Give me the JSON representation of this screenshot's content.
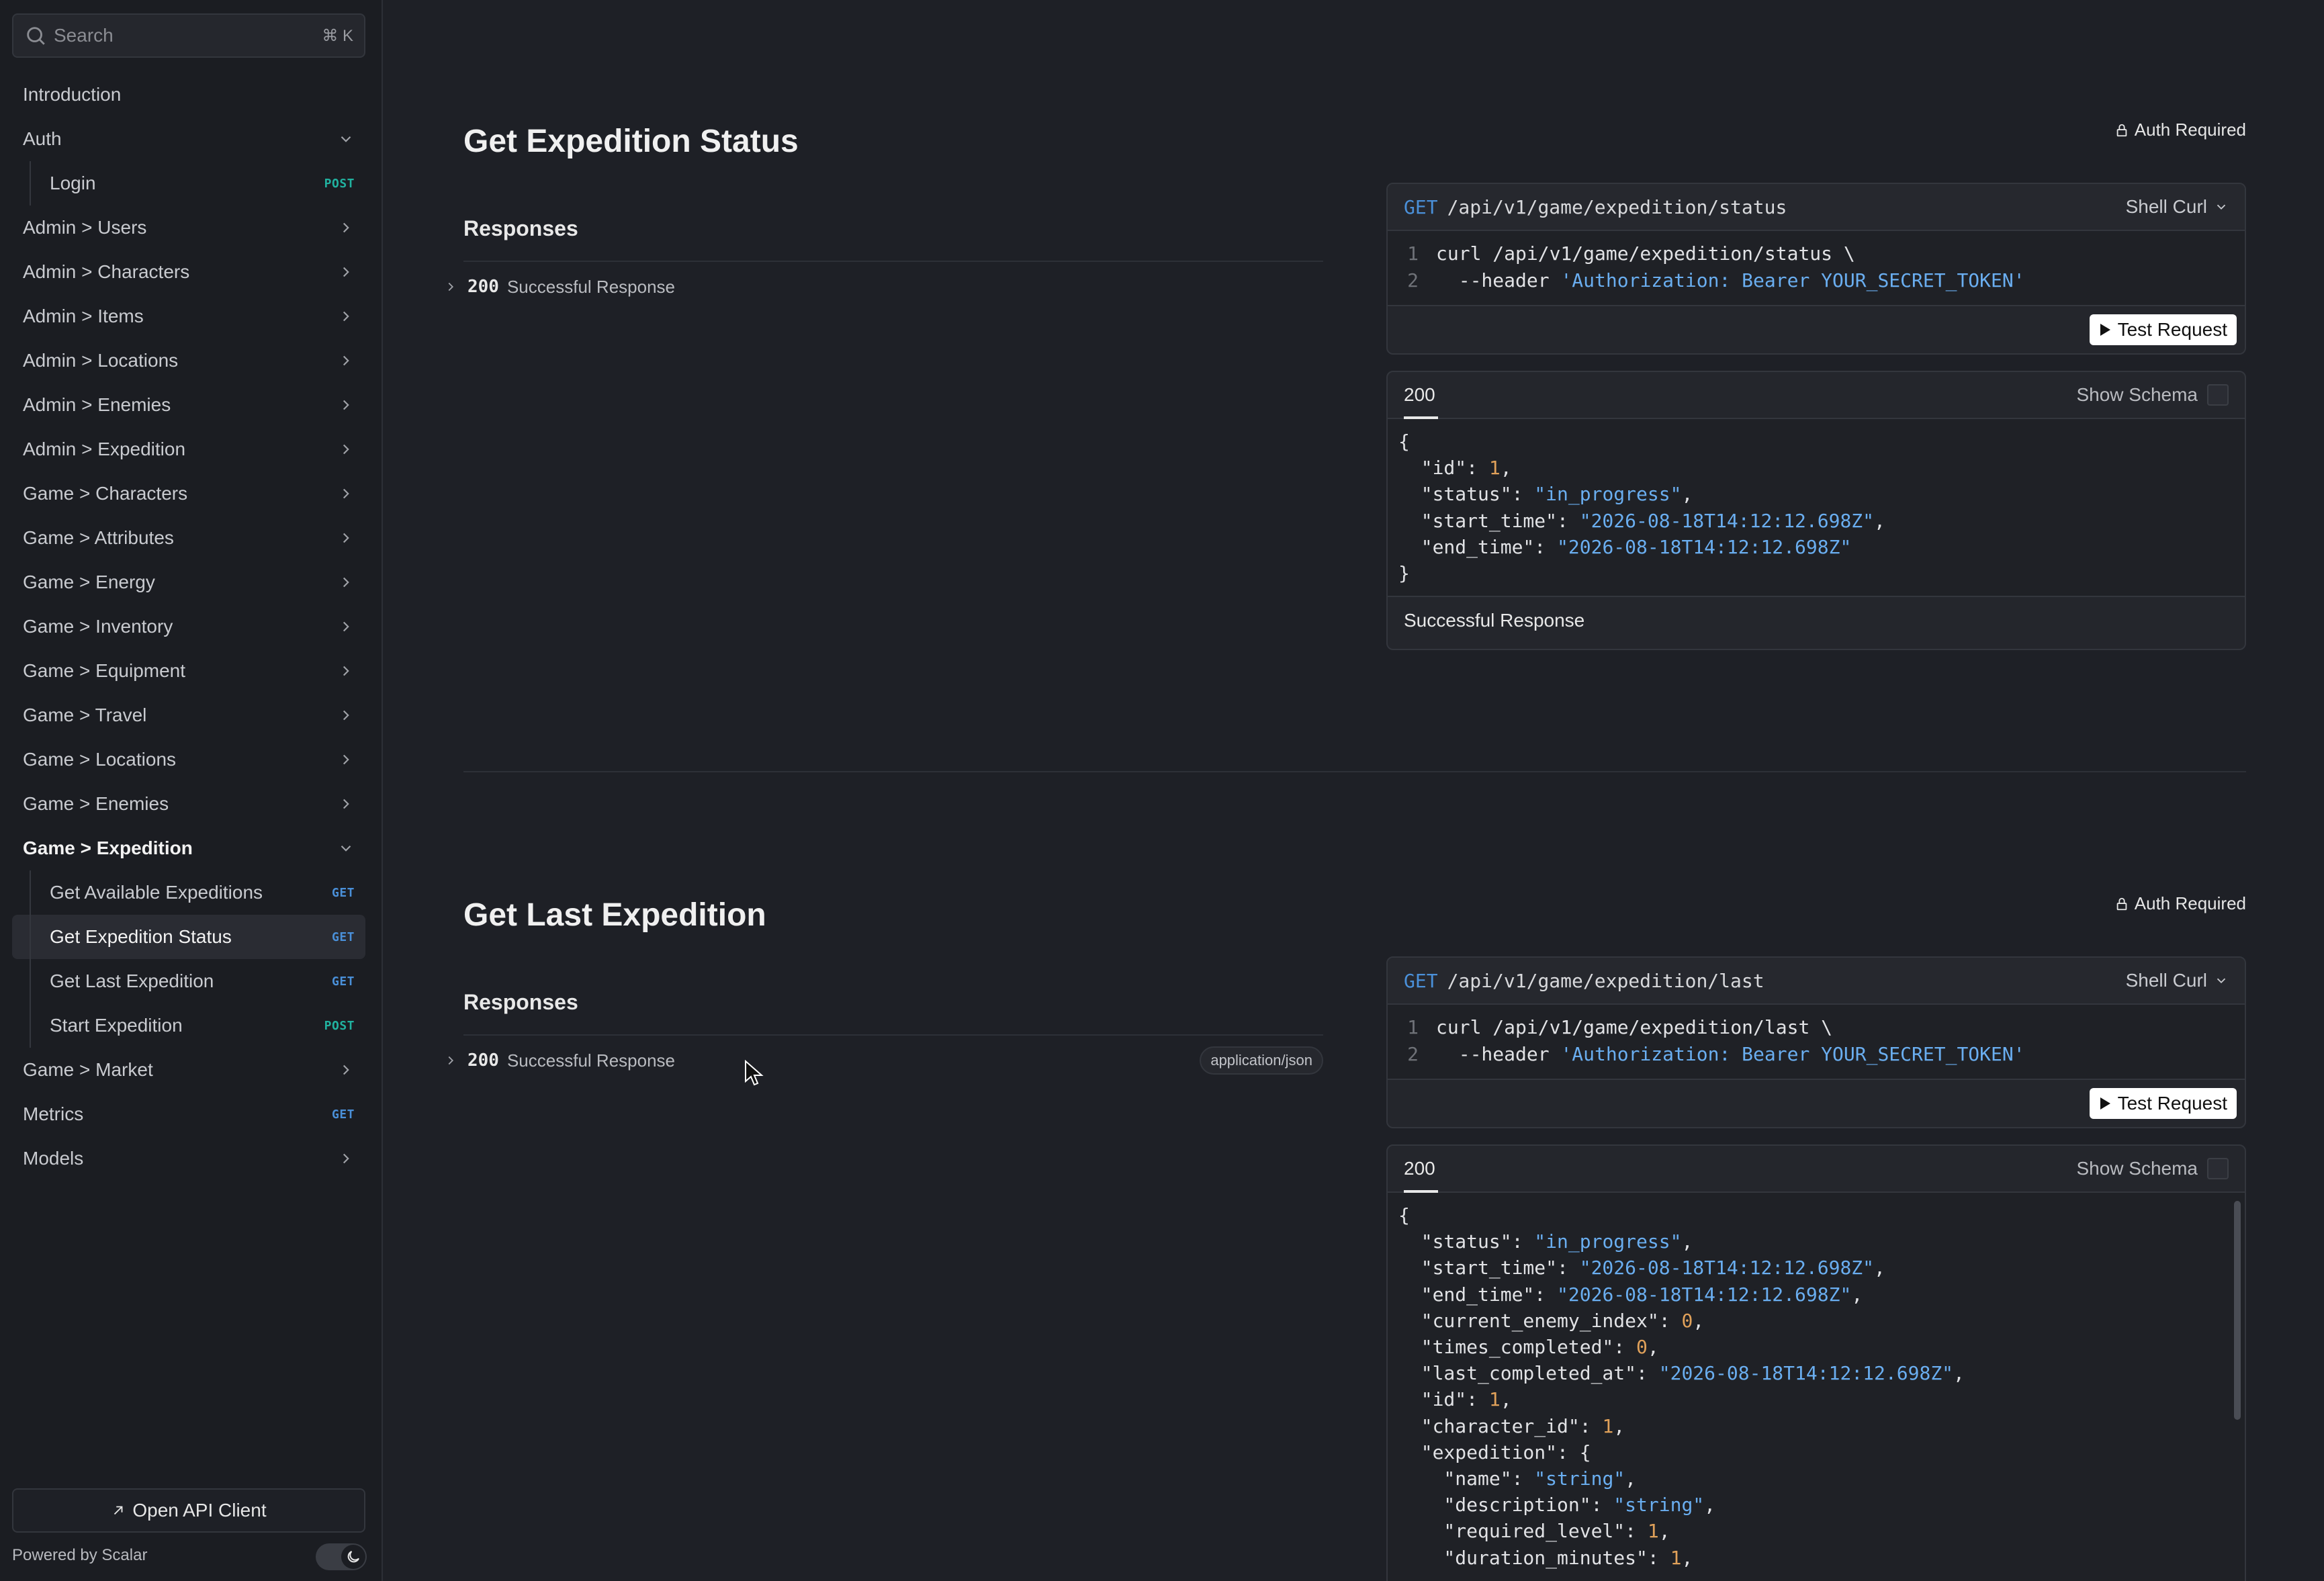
{
  "sidebar": {
    "search": {
      "placeholder": "Search",
      "shortcut": "⌘ K"
    },
    "items": [
      {
        "label": "Introduction"
      },
      {
        "label": "Auth"
      },
      {
        "label": "Login",
        "badge": "POST"
      },
      {
        "label": "Admin > Users"
      },
      {
        "label": "Admin > Characters"
      },
      {
        "label": "Admin > Items"
      },
      {
        "label": "Admin > Locations"
      },
      {
        "label": "Admin > Enemies"
      },
      {
        "label": "Admin > Expedition"
      },
      {
        "label": "Game > Characters"
      },
      {
        "label": "Game > Attributes"
      },
      {
        "label": "Game > Energy"
      },
      {
        "label": "Game > Inventory"
      },
      {
        "label": "Game > Equipment"
      },
      {
        "label": "Game > Travel"
      },
      {
        "label": "Game > Locations"
      },
      {
        "label": "Game > Enemies"
      },
      {
        "label": "Game > Expedition"
      },
      {
        "label": "Get Available Expeditions",
        "badge": "GET"
      },
      {
        "label": "Get Expedition Status",
        "badge": "GET"
      },
      {
        "label": "Get Last Expedition",
        "badge": "GET"
      },
      {
        "label": "Start Expedition",
        "badge": "POST"
      },
      {
        "label": "Game > Market"
      },
      {
        "label": "Metrics",
        "badge": "GET"
      },
      {
        "label": "Models"
      }
    ],
    "open_client": "Open API Client",
    "powered_by": "Powered by Scalar"
  },
  "sections": [
    {
      "title": "Get Expedition Status",
      "auth": "Auth Required",
      "responses_heading": "Responses",
      "response_code": "200",
      "response_desc": "Successful Response",
      "request": {
        "method": "GET",
        "path": "/api/v1/game/expedition/status",
        "lang": "Shell Curl",
        "line1": "curl /api/v1/game/expedition/status \\",
        "line2_flag": "  --header ",
        "line2_value": "'Authorization: Bearer YOUR_SECRET_TOKEN'",
        "test_button": "Test Request"
      },
      "response_panel": {
        "tab": "200",
        "show_schema": "Show Schema",
        "footer": "Successful Response"
      }
    },
    {
      "title": "Get Last Expedition",
      "auth": "Auth Required",
      "responses_heading": "Responses",
      "response_code": "200",
      "response_desc": "Successful Response",
      "content_type": "application/json",
      "request": {
        "method": "GET",
        "path": "/api/v1/game/expedition/last",
        "lang": "Shell Curl",
        "line1": "curl /api/v1/game/expedition/last \\",
        "line2_flag": "  --header ",
        "line2_value": "'Authorization: Bearer YOUR_SECRET_TOKEN'",
        "test_button": "Test Request"
      },
      "response_panel": {
        "tab": "200",
        "show_schema": "Show Schema"
      }
    }
  ],
  "json1": [
    {
      "t": "{"
    },
    {
      "k": "  \"id\": ",
      "n": "1",
      "e": ","
    },
    {
      "k": "  \"status\": ",
      "s": "\"in_progress\"",
      "e": ","
    },
    {
      "k": "  \"start_time\": ",
      "s": "\"2026-08-18T14:12:12.698Z\"",
      "e": ","
    },
    {
      "k": "  \"end_time\": ",
      "s": "\"2026-08-18T14:12:12.698Z\"",
      "e": ""
    },
    {
      "t": "}"
    }
  ],
  "json2": [
    {
      "t": "{"
    },
    {
      "k": "  \"status\": ",
      "s": "\"in_progress\"",
      "e": ","
    },
    {
      "k": "  \"start_time\": ",
      "s": "\"2026-08-18T14:12:12.698Z\"",
      "e": ","
    },
    {
      "k": "  \"end_time\": ",
      "s": "\"2026-08-18T14:12:12.698Z\"",
      "e": ","
    },
    {
      "k": "  \"current_enemy_index\": ",
      "n": "0",
      "e": ","
    },
    {
      "k": "  \"times_completed\": ",
      "n": "0",
      "e": ","
    },
    {
      "k": "  \"last_completed_at\": ",
      "s": "\"2026-08-18T14:12:12.698Z\"",
      "e": ","
    },
    {
      "k": "  \"id\": ",
      "n": "1",
      "e": ","
    },
    {
      "k": "  \"character_id\": ",
      "n": "1",
      "e": ","
    },
    {
      "k": "  \"expedition\": ",
      "t2": "{"
    },
    {
      "k": "    \"name\": ",
      "s": "\"string\"",
      "e": ","
    },
    {
      "k": "    \"description\": ",
      "s": "\"string\"",
      "e": ","
    },
    {
      "k": "    \"required_level\": ",
      "n": "1",
      "e": ","
    },
    {
      "k": "    \"duration_minutes\": ",
      "n": "1",
      "e": ","
    }
  ]
}
